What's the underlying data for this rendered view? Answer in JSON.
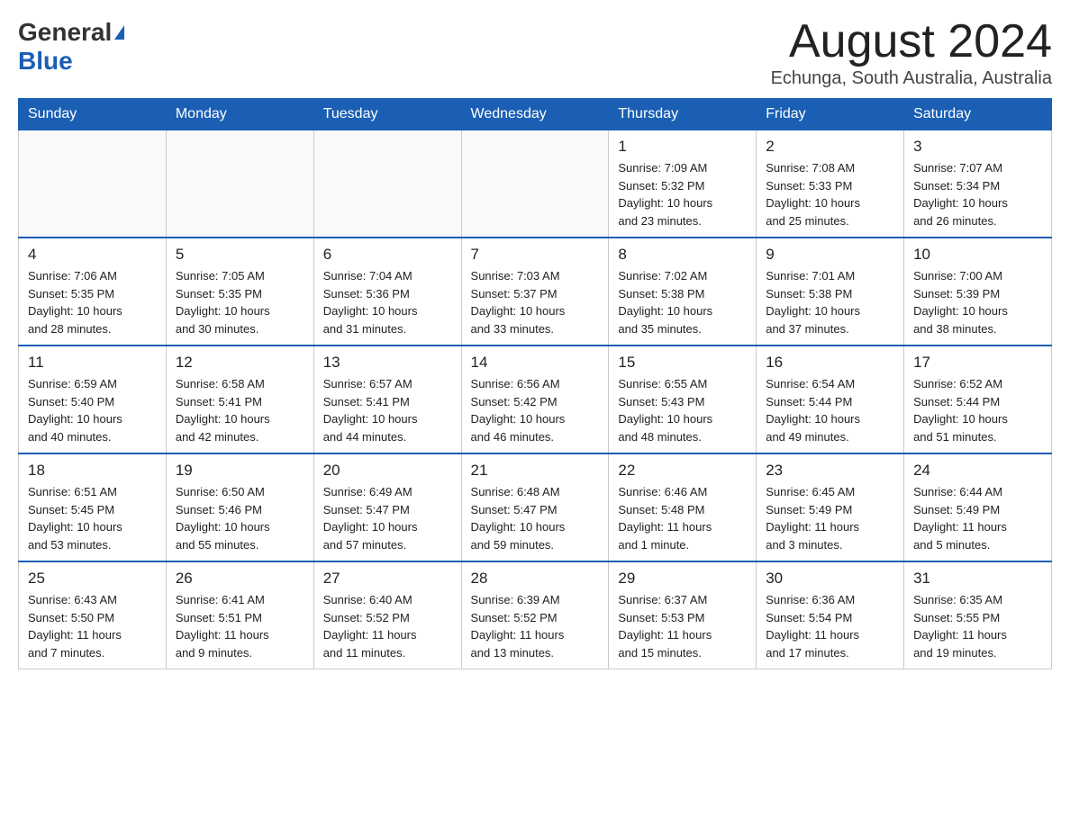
{
  "header": {
    "logo_general": "General",
    "logo_blue": "Blue",
    "month_title": "August 2024",
    "location": "Echunga, South Australia, Australia"
  },
  "calendar": {
    "days_of_week": [
      "Sunday",
      "Monday",
      "Tuesday",
      "Wednesday",
      "Thursday",
      "Friday",
      "Saturday"
    ],
    "weeks": [
      [
        {
          "day": "",
          "info": ""
        },
        {
          "day": "",
          "info": ""
        },
        {
          "day": "",
          "info": ""
        },
        {
          "day": "",
          "info": ""
        },
        {
          "day": "1",
          "info": "Sunrise: 7:09 AM\nSunset: 5:32 PM\nDaylight: 10 hours\nand 23 minutes."
        },
        {
          "day": "2",
          "info": "Sunrise: 7:08 AM\nSunset: 5:33 PM\nDaylight: 10 hours\nand 25 minutes."
        },
        {
          "day": "3",
          "info": "Sunrise: 7:07 AM\nSunset: 5:34 PM\nDaylight: 10 hours\nand 26 minutes."
        }
      ],
      [
        {
          "day": "4",
          "info": "Sunrise: 7:06 AM\nSunset: 5:35 PM\nDaylight: 10 hours\nand 28 minutes."
        },
        {
          "day": "5",
          "info": "Sunrise: 7:05 AM\nSunset: 5:35 PM\nDaylight: 10 hours\nand 30 minutes."
        },
        {
          "day": "6",
          "info": "Sunrise: 7:04 AM\nSunset: 5:36 PM\nDaylight: 10 hours\nand 31 minutes."
        },
        {
          "day": "7",
          "info": "Sunrise: 7:03 AM\nSunset: 5:37 PM\nDaylight: 10 hours\nand 33 minutes."
        },
        {
          "day": "8",
          "info": "Sunrise: 7:02 AM\nSunset: 5:38 PM\nDaylight: 10 hours\nand 35 minutes."
        },
        {
          "day": "9",
          "info": "Sunrise: 7:01 AM\nSunset: 5:38 PM\nDaylight: 10 hours\nand 37 minutes."
        },
        {
          "day": "10",
          "info": "Sunrise: 7:00 AM\nSunset: 5:39 PM\nDaylight: 10 hours\nand 38 minutes."
        }
      ],
      [
        {
          "day": "11",
          "info": "Sunrise: 6:59 AM\nSunset: 5:40 PM\nDaylight: 10 hours\nand 40 minutes."
        },
        {
          "day": "12",
          "info": "Sunrise: 6:58 AM\nSunset: 5:41 PM\nDaylight: 10 hours\nand 42 minutes."
        },
        {
          "day": "13",
          "info": "Sunrise: 6:57 AM\nSunset: 5:41 PM\nDaylight: 10 hours\nand 44 minutes."
        },
        {
          "day": "14",
          "info": "Sunrise: 6:56 AM\nSunset: 5:42 PM\nDaylight: 10 hours\nand 46 minutes."
        },
        {
          "day": "15",
          "info": "Sunrise: 6:55 AM\nSunset: 5:43 PM\nDaylight: 10 hours\nand 48 minutes."
        },
        {
          "day": "16",
          "info": "Sunrise: 6:54 AM\nSunset: 5:44 PM\nDaylight: 10 hours\nand 49 minutes."
        },
        {
          "day": "17",
          "info": "Sunrise: 6:52 AM\nSunset: 5:44 PM\nDaylight: 10 hours\nand 51 minutes."
        }
      ],
      [
        {
          "day": "18",
          "info": "Sunrise: 6:51 AM\nSunset: 5:45 PM\nDaylight: 10 hours\nand 53 minutes."
        },
        {
          "day": "19",
          "info": "Sunrise: 6:50 AM\nSunset: 5:46 PM\nDaylight: 10 hours\nand 55 minutes."
        },
        {
          "day": "20",
          "info": "Sunrise: 6:49 AM\nSunset: 5:47 PM\nDaylight: 10 hours\nand 57 minutes."
        },
        {
          "day": "21",
          "info": "Sunrise: 6:48 AM\nSunset: 5:47 PM\nDaylight: 10 hours\nand 59 minutes."
        },
        {
          "day": "22",
          "info": "Sunrise: 6:46 AM\nSunset: 5:48 PM\nDaylight: 11 hours\nand 1 minute."
        },
        {
          "day": "23",
          "info": "Sunrise: 6:45 AM\nSunset: 5:49 PM\nDaylight: 11 hours\nand 3 minutes."
        },
        {
          "day": "24",
          "info": "Sunrise: 6:44 AM\nSunset: 5:49 PM\nDaylight: 11 hours\nand 5 minutes."
        }
      ],
      [
        {
          "day": "25",
          "info": "Sunrise: 6:43 AM\nSunset: 5:50 PM\nDaylight: 11 hours\nand 7 minutes."
        },
        {
          "day": "26",
          "info": "Sunrise: 6:41 AM\nSunset: 5:51 PM\nDaylight: 11 hours\nand 9 minutes."
        },
        {
          "day": "27",
          "info": "Sunrise: 6:40 AM\nSunset: 5:52 PM\nDaylight: 11 hours\nand 11 minutes."
        },
        {
          "day": "28",
          "info": "Sunrise: 6:39 AM\nSunset: 5:52 PM\nDaylight: 11 hours\nand 13 minutes."
        },
        {
          "day": "29",
          "info": "Sunrise: 6:37 AM\nSunset: 5:53 PM\nDaylight: 11 hours\nand 15 minutes."
        },
        {
          "day": "30",
          "info": "Sunrise: 6:36 AM\nSunset: 5:54 PM\nDaylight: 11 hours\nand 17 minutes."
        },
        {
          "day": "31",
          "info": "Sunrise: 6:35 AM\nSunset: 5:55 PM\nDaylight: 11 hours\nand 19 minutes."
        }
      ]
    ]
  }
}
